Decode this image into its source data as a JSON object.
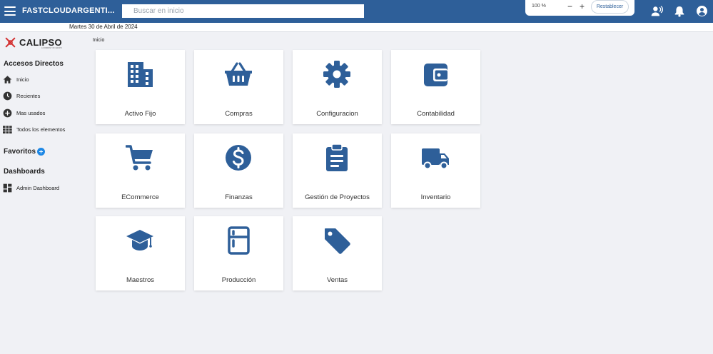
{
  "header": {
    "company": "FASTCLOUDARGENTI...",
    "search_placeholder": "Buscar en inicio",
    "zoom_value": "100 %",
    "zoom_minus": "−",
    "zoom_plus": "+",
    "reset_label": "Restablecer"
  },
  "date": "Martes 30 de Abril de 2024",
  "logo": {
    "text": "CALIPSO",
    "sub": "A COMPANY OF GRUPO"
  },
  "sidebar": {
    "quick_access_title": "Accesos Directos",
    "items": [
      {
        "label": "Inicio",
        "icon": "home-icon"
      },
      {
        "label": "Recientes",
        "icon": "clock-icon"
      },
      {
        "label": "Mas usados",
        "icon": "plus-circle-icon"
      },
      {
        "label": "Todos los elementos",
        "icon": "grid-icon"
      }
    ],
    "favorites_title": "Favoritos",
    "dashboards_title": "Dashboards",
    "dashboards": [
      {
        "label": "Admin Dashboard",
        "icon": "dashboard-icon"
      }
    ]
  },
  "breadcrumb": "Inicio",
  "tiles": [
    {
      "label": "Activo Fijo",
      "icon": "building-icon"
    },
    {
      "label": "Compras",
      "icon": "basket-icon"
    },
    {
      "label": "Configuracion",
      "icon": "gear-icon"
    },
    {
      "label": "Contabilidad",
      "icon": "wallet-icon"
    },
    {
      "label": "ECommerce",
      "icon": "cart-icon"
    },
    {
      "label": "Finanzas",
      "icon": "dollar-icon"
    },
    {
      "label": "Gestión de Proyectos",
      "icon": "clipboard-icon"
    },
    {
      "label": "Inventario",
      "icon": "truck-icon"
    },
    {
      "label": "Maestros",
      "icon": "graduation-cap-icon"
    },
    {
      "label": "Producción",
      "icon": "fridge-icon"
    },
    {
      "label": "Ventas",
      "icon": "tag-icon"
    }
  ],
  "colors": {
    "primary": "#2e5f99",
    "background": "#f0f1f5",
    "accent": "#1e88e5"
  }
}
